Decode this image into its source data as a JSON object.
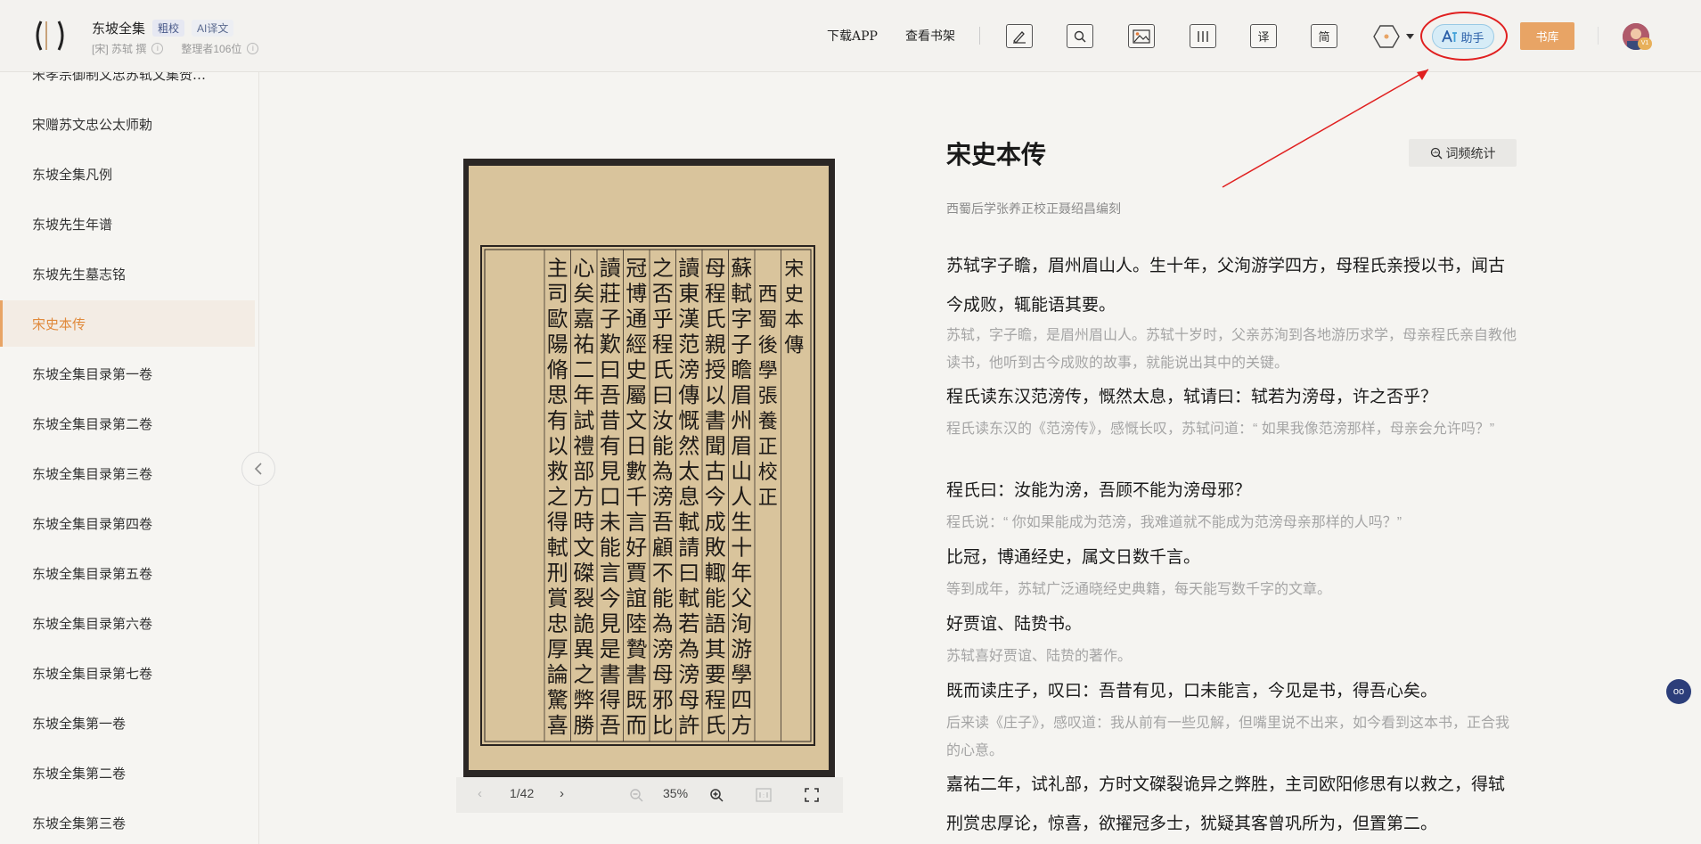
{
  "header": {
    "book_title": "东坡全集",
    "tag_collated": "粗校",
    "tag_ai": "AI译文",
    "author": "[宋] 苏轼 撰",
    "editors": "整理者106位",
    "nav_download": "下载APP",
    "nav_bookshelf": "查看书架",
    "tool_translate": "译",
    "tool_simplified": "简",
    "assistant_label": "助手",
    "library_label": "书库",
    "avatar_badge": "V1"
  },
  "sidebar": {
    "items": [
      {
        "label": "宋孝宗御制文忠苏轼文集赞…"
      },
      {
        "label": "宋赠苏文忠公太师勅"
      },
      {
        "label": "东坡全集凡例"
      },
      {
        "label": "东坡先生年谱"
      },
      {
        "label": "东坡先生墓志铭"
      },
      {
        "label": "宋史本传"
      },
      {
        "label": "东坡全集目录第一卷"
      },
      {
        "label": "东坡全集目录第二卷"
      },
      {
        "label": "东坡全集目录第三卷"
      },
      {
        "label": "东坡全集目录第四卷"
      },
      {
        "label": "东坡全集目录第五卷"
      },
      {
        "label": "东坡全集目录第六卷"
      },
      {
        "label": "东坡全集目录第七卷"
      },
      {
        "label": "东坡全集第一卷"
      },
      {
        "label": "东坡全集第二卷"
      },
      {
        "label": "东坡全集第三卷"
      }
    ],
    "active_index": 5
  },
  "viewer": {
    "page_indicator": "1/42",
    "zoom": "35%",
    "page_header": "宋史本傳",
    "columns": [
      "西蜀後學張養正校正",
      "蘇軾字子瞻眉州眉山人生十年父洵游學四方",
      "母程氏親授以書聞古今成敗輙能語其要程氏",
      "讀東漢范滂傳慨然太息軾請曰軾若為滂母許",
      "之否乎程氏曰汝能為滂吾顧不能為滂母邪比",
      "冠博通經史屬文日數千言好賈誼陸贄書既而",
      "讀莊子歎曰吾昔有見口未能言今見是書得吾",
      "心矣嘉祐二年試禮部方時文磔裂詭異之弊勝",
      "主司歐陽脩思有以救之得軾刑賞忠厚論驚喜"
    ]
  },
  "content": {
    "title": "宋史本传",
    "freq_button": "词频统计",
    "subtitle": "西蜀后学张养正校正聂绍昌编刻",
    "paragraphs": [
      {
        "orig": "苏轼字子瞻，眉州眉山人。生十年，父洵游学四方，母程氏亲授以书，闻古今成败，辄能语其要。",
        "trans": "苏轼，字子瞻，是眉州眉山人。苏轼十岁时，父亲苏洵到各地游历求学，母亲程氏亲自教他读书，他听到古今成败的故事，就能说出其中的关键。"
      },
      {
        "orig": "程氏读东汉范滂传，慨然太息，轼请曰：轼若为滂母，许之否乎？",
        "trans": "程氏读东汉的《范滂传》，感慨长叹，苏轼问道：“ 如果我像范滂那样，母亲会允许吗？”"
      },
      {
        "orig": "程氏曰：汝能为滂，吾顾不能为滂母邪？",
        "trans": "程氏说：“ 你如果能成为范滂，我难道就不能成为范滂母亲那样的人吗？”"
      },
      {
        "orig": "比冠，博通经史，属文日数千言。",
        "trans": "等到成年，苏轼广泛通晓经史典籍，每天能写数千字的文章。"
      },
      {
        "orig": "好贾谊、陆贽书。",
        "trans": "苏轼喜好贾谊、陆贽的著作。"
      },
      {
        "orig": "既而读庄子，叹曰：吾昔有见，口未能言，今见是书，得吾心矣。",
        "trans": "后来读《庄子》，感叹道：我从前有一些见解，但嘴里说不出来，如今看到这本书，正合我的心意。"
      },
      {
        "orig": "嘉祐二年，试礼部，方时文磔裂诡异之弊胜，主司欧阳修思有以救之，得轼刑赏忠厚论，惊喜，欲擢冠多士，犹疑其客曾巩所为，但置第二。",
        "trans": ""
      }
    ]
  },
  "float_button": "oo"
}
